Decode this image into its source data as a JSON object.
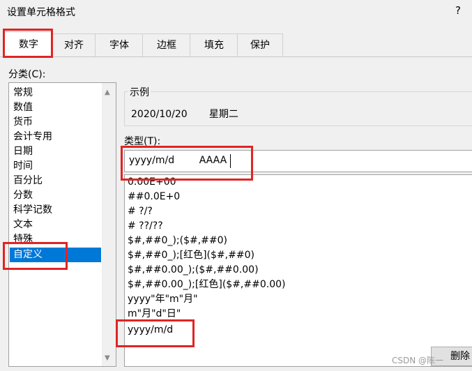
{
  "window": {
    "title": "设置单元格格式",
    "help_label": "?"
  },
  "tabs": [
    "数字",
    "对齐",
    "字体",
    "边框",
    "填充",
    "保护"
  ],
  "category": {
    "label": "分类(C):",
    "items": [
      "常规",
      "数值",
      "货币",
      "会计专用",
      "日期",
      "时间",
      "百分比",
      "分数",
      "科学记数",
      "文本",
      "特殊",
      "自定义"
    ],
    "selected": "自定义"
  },
  "sample": {
    "legend": "示例",
    "value": "2020/10/20       星期二"
  },
  "type": {
    "label": "类型(T):",
    "value": "yyyy/m/d        AAAA",
    "formats": [
      "0.00E+00",
      "##0.0E+0",
      "# ?/?",
      "# ??/??",
      "$#,##0_);($#,##0)",
      "$#,##0_);[红色]($#,##0)",
      "$#,##0.00_);($#,##0.00)",
      "$#,##0.00_);[红色]($#,##0.00)",
      "yyyy\"年\"m\"月\"",
      "m\"月\"d\"日\"",
      "yyyy/m/d"
    ]
  },
  "buttons": {
    "delete": "删除"
  },
  "watermark": "CSDN @陈一",
  "colors": {
    "selection": "#0078d7",
    "highlight": "#e02424"
  },
  "icons": {
    "scroll_up": "▲",
    "scroll_down": "▼"
  }
}
